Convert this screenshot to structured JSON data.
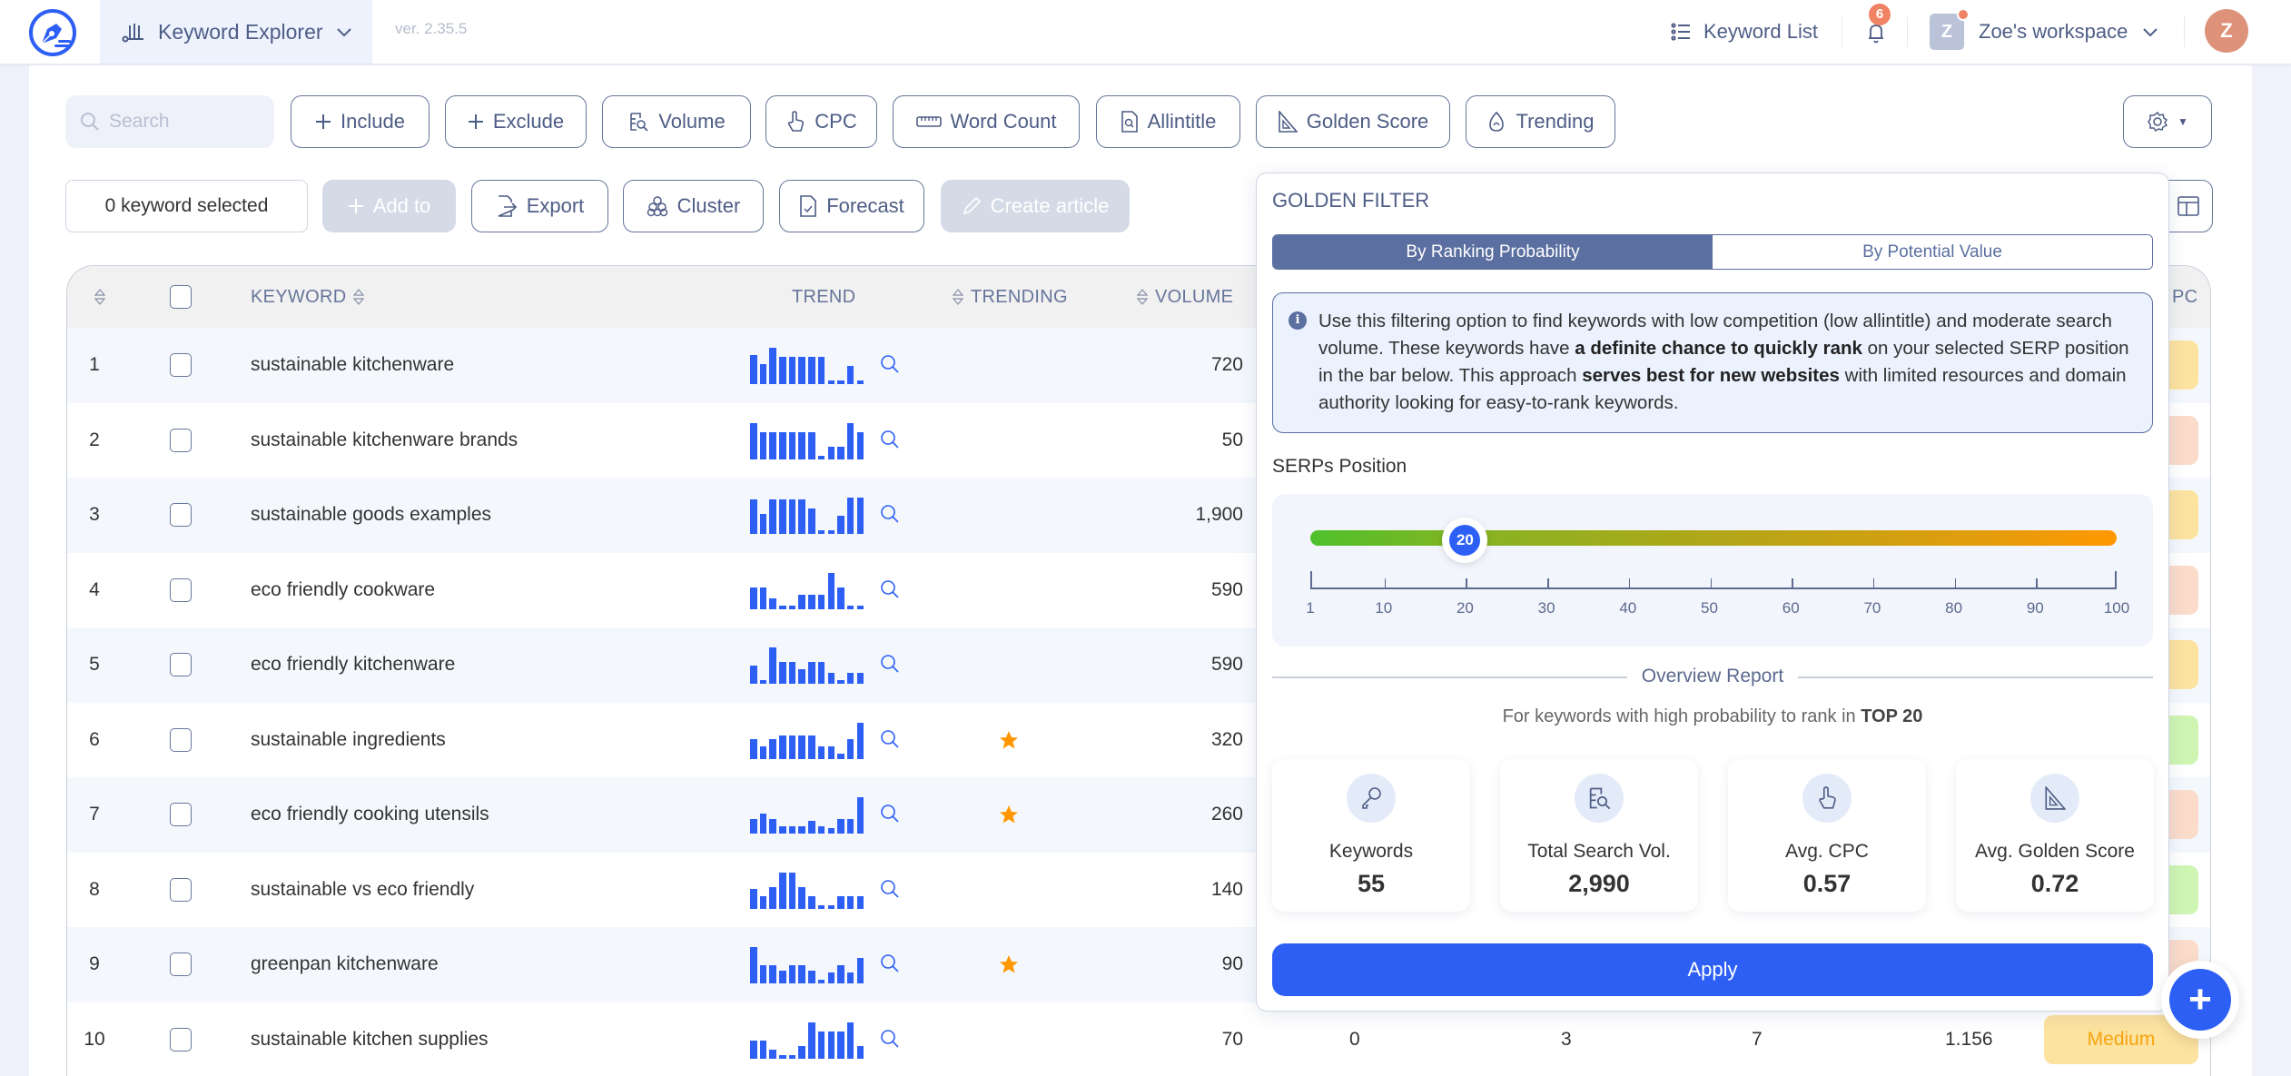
{
  "header": {
    "app_name": "Keyword Explorer",
    "version": "ver. 2.35.5",
    "keyword_list_label": "Keyword List",
    "notification_count": "6",
    "workspace_initial": "Z",
    "workspace_name": "Zoe's workspace",
    "user_initial": "Z"
  },
  "toolbar": {
    "search_placeholder": "Search",
    "filters": [
      {
        "label": "Include",
        "icon": "plus-icon"
      },
      {
        "label": "Exclude",
        "icon": "plus-icon"
      },
      {
        "label": "Volume",
        "icon": "volume-search-icon"
      },
      {
        "label": "CPC",
        "icon": "pointer-hand-icon"
      },
      {
        "label": "Word Count",
        "icon": "ruler-icon"
      },
      {
        "label": "Allintitle",
        "icon": "document-search-icon"
      },
      {
        "label": "Golden Score",
        "icon": "set-square-icon"
      },
      {
        "label": "Trending",
        "icon": "flame-icon"
      }
    ],
    "selected_count_text": "0 keyword selected",
    "actions": {
      "add_to": "Add to",
      "export": "Export",
      "cluster": "Cluster",
      "forecast": "Forecast",
      "create_article": "Create article"
    }
  },
  "table": {
    "columns": {
      "keyword": "KEYWORD",
      "trend": "TREND",
      "trending": "TRENDING",
      "volume": "VOLUME",
      "cpc_partial": "PC"
    },
    "rows": [
      {
        "n": "1",
        "keyword": "sustainable kitchenware",
        "trend": [
          0.8,
          0.55,
          1.0,
          0.75,
          0.75,
          0.75,
          0.75,
          0.75,
          0.1,
          0.1,
          0.5,
          0.1
        ],
        "trending": false,
        "volume": "720",
        "badge_color": "#fde3a0"
      },
      {
        "n": "2",
        "keyword": "sustainable kitchenware brands",
        "trend": [
          1.0,
          0.75,
          0.75,
          0.75,
          0.75,
          0.75,
          0.75,
          0.1,
          0.35,
          0.35,
          1.0,
          0.75
        ],
        "trending": false,
        "volume": "50",
        "badge_color": "#fbdccb"
      },
      {
        "n": "3",
        "keyword": "sustainable goods examples",
        "trend": [
          0.95,
          0.55,
          0.95,
          0.95,
          0.95,
          0.95,
          0.7,
          0.1,
          0.1,
          0.5,
          1.0,
          1.0
        ],
        "trending": false,
        "volume": "1,900",
        "badge_color": "#fde3a0"
      },
      {
        "n": "4",
        "keyword": "eco friendly cookware",
        "trend": [
          0.6,
          0.6,
          0.3,
          0.1,
          0.1,
          0.4,
          0.4,
          0.4,
          1.0,
          0.6,
          0.1,
          0.1
        ],
        "trending": false,
        "volume": "590",
        "badge_color": "#fbdccb"
      },
      {
        "n": "5",
        "keyword": "eco friendly kitchenware",
        "trend": [
          0.5,
          0.1,
          1.0,
          0.6,
          0.6,
          0.4,
          0.6,
          0.6,
          0.3,
          0.1,
          0.3,
          0.3
        ],
        "trending": false,
        "volume": "590",
        "badge_color": "#fde3a0"
      },
      {
        "n": "6",
        "keyword": "sustainable ingredients",
        "trend": [
          0.55,
          0.35,
          0.55,
          0.65,
          0.65,
          0.65,
          0.65,
          0.35,
          0.35,
          0.15,
          0.55,
          1.0
        ],
        "trending": true,
        "volume": "320",
        "badge_color": "#cff5b3"
      },
      {
        "n": "7",
        "keyword": "eco friendly cooking utensils",
        "trend": [
          0.4,
          0.55,
          0.4,
          0.2,
          0.2,
          0.2,
          0.35,
          0.2,
          0.15,
          0.4,
          0.4,
          1.0
        ],
        "trending": true,
        "volume": "260",
        "badge_color": "#fbdccb"
      },
      {
        "n": "8",
        "keyword": "sustainable vs eco friendly",
        "trend": [
          0.55,
          0.35,
          0.6,
          1.0,
          1.0,
          0.6,
          0.35,
          0.1,
          0.1,
          0.35,
          0.35,
          0.35
        ],
        "trending": false,
        "volume": "140",
        "badge_color": "#cff5b3"
      },
      {
        "n": "9",
        "keyword": "greenpan kitchenware",
        "trend": [
          1.0,
          0.5,
          0.5,
          0.35,
          0.5,
          0.5,
          0.35,
          0.1,
          0.3,
          0.5,
          0.3,
          0.7
        ],
        "trending": true,
        "volume": "90",
        "badge_color": "#fbdccb"
      },
      {
        "n": "10",
        "keyword": "sustainable kitchen supplies",
        "trend": [
          0.5,
          0.5,
          0.25,
          0.05,
          0.05,
          0.35,
          1.0,
          0.75,
          0.75,
          0.75,
          1.0,
          0.35
        ],
        "trending": false,
        "volume": "70",
        "badge_color": "#fde3a0",
        "extra": {
          "col_a": "0",
          "col_b": "3",
          "col_c": "7",
          "col_d": "1.156",
          "badge": "Medium"
        }
      }
    ]
  },
  "golden_filter": {
    "title": "GOLDEN FILTER",
    "tabs": [
      {
        "label": "By Ranking Probability",
        "active": true
      },
      {
        "label": "By Potential Value",
        "active": false
      }
    ],
    "info": {
      "part1": "Use this filtering option to find keywords with low competition (low allintitle) and moderate search volume. These keywords have ",
      "bold1": "a definite chance to quickly rank",
      "part2": " on your selected SERP position in the bar below. This approach ",
      "bold2": "serves best for new websites",
      "part3": " with limited resources and domain authority looking for easy-to-rank keywords."
    },
    "serp_label": "SERPs Position",
    "slider": {
      "min": 1,
      "max": 100,
      "value": 20,
      "value_text": "20",
      "ticks": [
        "1",
        "10",
        "20",
        "30",
        "40",
        "50",
        "60",
        "70",
        "80",
        "90",
        "100"
      ]
    },
    "overview_title": "Overview Report",
    "overview_sub_prefix": "For keywords with high probability to rank in ",
    "overview_sub_bold": "TOP 20",
    "stats": [
      {
        "label": "Keywords",
        "value": "55",
        "icon": "key-icon"
      },
      {
        "label": "Total Search Vol.",
        "value": "2,990",
        "icon": "volume-search-icon"
      },
      {
        "label": "Avg. CPC",
        "value": "0.57",
        "icon": "pointer-hand-icon"
      },
      {
        "label": "Avg. Golden Score",
        "value": "0.72",
        "icon": "set-square-icon"
      }
    ],
    "apply_label": "Apply"
  },
  "colors": {
    "accent": "#2d5ff5",
    "slate": "#5b6fa0",
    "star": "#ff9800",
    "badge_medium_text": "#f5a40f"
  },
  "fab_label": "+"
}
